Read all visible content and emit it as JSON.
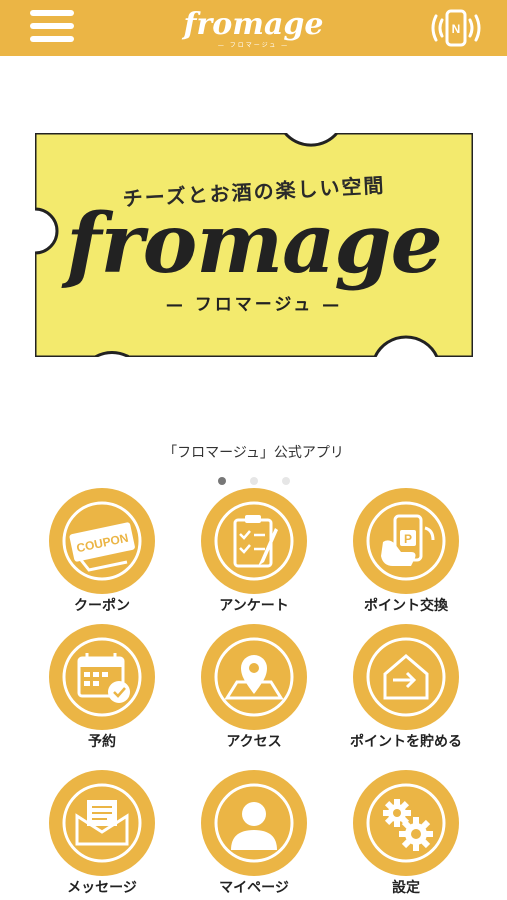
{
  "header": {
    "brand": "fromage",
    "brand_sub": "— フロマージュ —",
    "menu_icon": "hamburger-icon",
    "nfc_icon": "nfc-phone-icon"
  },
  "banner": {
    "tagline": "チーズとお酒の楽しい空間",
    "title": "fromage",
    "subtitle": "— フロマージュ —"
  },
  "caption": "「フロマージュ」公式アプリ",
  "pager": {
    "total": 3,
    "active": 1
  },
  "menu": [
    {
      "label": "クーポン",
      "icon": "coupon-icon",
      "badge": "COUPON"
    },
    {
      "label": "アンケート",
      "icon": "survey-clipboard-icon"
    },
    {
      "label": "ポイント交換",
      "icon": "point-exchange-icon",
      "badge": "P"
    },
    {
      "label": "予約",
      "icon": "calendar-reservation-icon"
    },
    {
      "label": "アクセス",
      "icon": "map-pin-icon"
    },
    {
      "label": "ポイントを貯める",
      "icon": "point-checkin-icon"
    },
    {
      "label": "メッセージ",
      "icon": "message-envelope-icon"
    },
    {
      "label": "マイページ",
      "icon": "user-profile-icon"
    },
    {
      "label": "設定",
      "icon": "gears-settings-icon"
    }
  ],
  "colors": {
    "accent": "#ebb545",
    "banner": "#f3ea6d",
    "ink": "#222222"
  }
}
